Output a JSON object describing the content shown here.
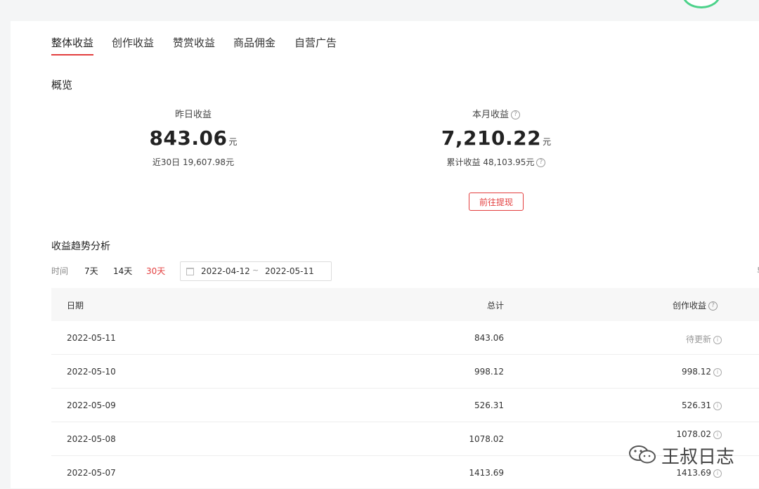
{
  "tabs": [
    "整体收益",
    "创作收益",
    "赞赏收益",
    "商品佣金",
    "自营广告"
  ],
  "overview": {
    "title": "概览",
    "yesterday": {
      "label": "昨日收益",
      "value": "843.06",
      "unit": "元",
      "sub": "近30日 19,607.98元"
    },
    "month": {
      "label": "本月收益",
      "value": "7,210.22",
      "unit": "元",
      "sub": "累计收益 48,103.95元"
    },
    "withdraw_button": "前往提现"
  },
  "trend": {
    "title": "收益趋势分析",
    "time_label": "时间",
    "options": [
      "7天",
      "14天",
      "30天"
    ],
    "active_option": "30天",
    "date_start": "2022-04-12",
    "date_sep": "~",
    "date_end": "2022-05-11",
    "right_edge_char": "导"
  },
  "table": {
    "headers": {
      "date": "日期",
      "total": "总计",
      "creation": "创作收益"
    },
    "rows": [
      {
        "date": "2022-05-11",
        "total": "843.06",
        "creation": "待更新"
      },
      {
        "date": "2022-05-10",
        "total": "998.12",
        "creation": "998.12"
      },
      {
        "date": "2022-05-09",
        "total": "526.31",
        "creation": "526.31"
      },
      {
        "date": "2022-05-08",
        "total": "1078.02",
        "creation": "1078.02"
      },
      {
        "date": "2022-05-07",
        "total": "1413.69",
        "creation": "1413.69"
      }
    ]
  },
  "watermark": {
    "text": "王叔日志",
    "icon": "wechat-icon"
  },
  "colors": {
    "accent": "#e33e3e",
    "avatar_ring": "#4cd28a"
  }
}
